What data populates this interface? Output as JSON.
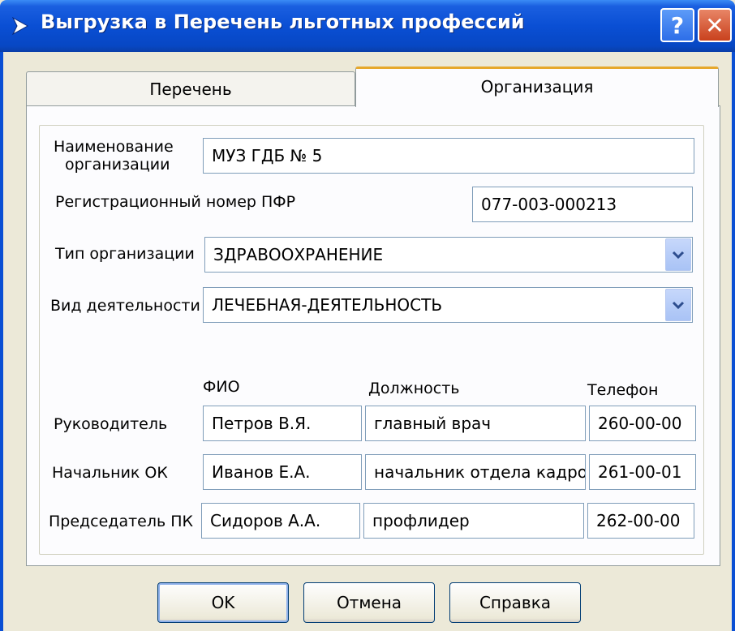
{
  "window": {
    "title": "Выгрузка в Перечень льготных профессий",
    "help_label": "?",
    "close_label": "✕"
  },
  "tabs": [
    {
      "label": "Перечень",
      "active": false
    },
    {
      "label": "Организация",
      "active": true
    }
  ],
  "form": {
    "org_name_label_line1": "Наименование",
    "org_name_label_line2": "организации",
    "org_name_value": "МУЗ ГДБ № 5",
    "pfr_label": "Регистрационный номер ПФР",
    "pfr_value": "077-003-000213",
    "org_type_label": "Тип организации",
    "org_type_value": "ЗДРАВООХРАНЕНИЕ",
    "activity_label": "Вид деятельности",
    "activity_value": "ЛЕЧЕБНАЯ-ДЕЯТЕЛЬНОСТЬ"
  },
  "people": {
    "headers": {
      "fio": "ФИО",
      "position": "Должность",
      "phone": "Телефон"
    },
    "rows": [
      {
        "role": "Руководитель",
        "fio": "Петров В.Я.",
        "position": "главный врач",
        "phone": "260-00-00"
      },
      {
        "role": "Начальник ОК",
        "fio": "Иванов Е.А.",
        "position": "начальник отдела кадров",
        "phone": "261-00-01"
      },
      {
        "role": "Председатель ПК",
        "fio": "Сидоров А.А.",
        "position": "профлидер",
        "phone": "262-00-00"
      }
    ]
  },
  "buttons": {
    "ok": "OK",
    "cancel": "Отмена",
    "help": "Справка"
  },
  "colors": {
    "titlebar": "#0a4fd4",
    "active_tab_highlight": "#e6a82c",
    "field_border": "#7f9db9",
    "dialog_bg": "#ece9d8"
  },
  "icons": {
    "title": "arrow-icon",
    "combo": "chevron-down-icon"
  }
}
